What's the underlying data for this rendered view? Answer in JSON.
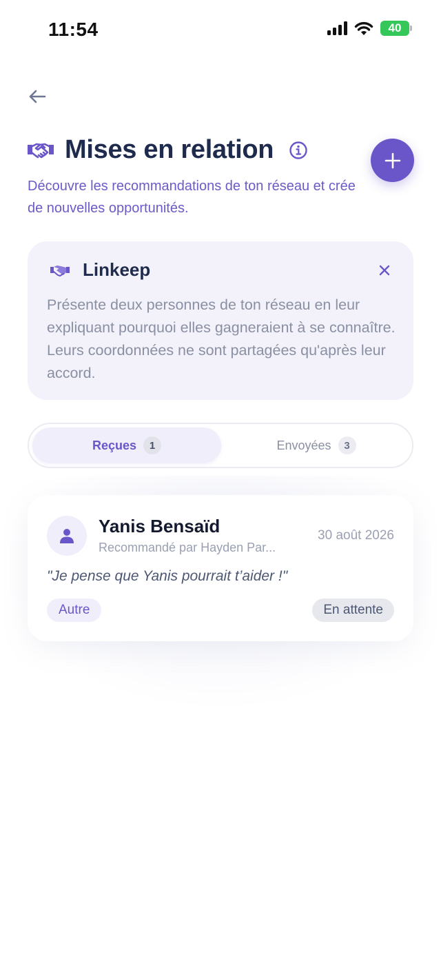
{
  "status_bar": {
    "time": "11:54",
    "battery": "40"
  },
  "header": {
    "title": "Mises en relation",
    "subtitle": "Découvre les recommandations de ton réseau et crée de nouvelles opportunités.",
    "icon": "handshake-icon",
    "accent_color": "#6b56c9"
  },
  "info_card": {
    "title": "Linkeep",
    "text": "Présente deux personnes de ton réseau en leur expliquant pourquoi elles gagneraient à se connaître. Leurs coordonnées ne sont partagées qu'après leur accord."
  },
  "tabs": [
    {
      "label": "Reçues",
      "count": "1",
      "active": true
    },
    {
      "label": "Envoyées",
      "count": "3",
      "active": false
    }
  ],
  "introductions": [
    {
      "name": "Yanis Bensaïd",
      "recommended_by": "Recommandé par Hayden Par...",
      "date": "30 août 2026",
      "quote": "\"Je pense que Yanis pourrait t’aider !\"",
      "category": "Autre",
      "status": "En attente"
    }
  ]
}
